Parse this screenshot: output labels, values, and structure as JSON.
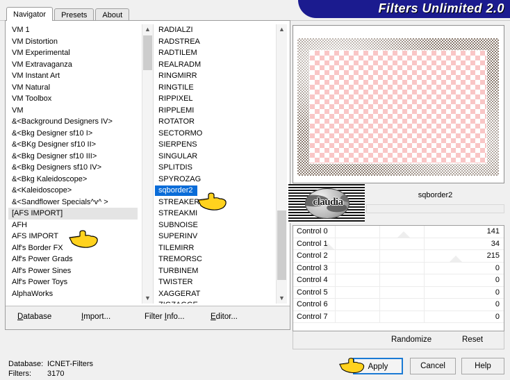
{
  "window": {
    "title": "Filters Unlimited 2.0",
    "title_color": "#1b1b8f"
  },
  "tabs": [
    {
      "label": "Navigator",
      "active": true
    },
    {
      "label": "Presets",
      "active": false
    },
    {
      "label": "About",
      "active": false
    }
  ],
  "category_list": {
    "name": "filter-category-list",
    "selected": "[AFS IMPORT]",
    "items": [
      "VM 1",
      "VM Distortion",
      "VM Experimental",
      "VM Extravaganza",
      "VM Instant Art",
      "VM Natural",
      "VM Toolbox",
      "VM",
      "&<Background Designers IV>",
      "&<Bkg Designer sf10 I>",
      "&<BKg Designer sf10 II>",
      "&<Bkg Designer sf10 III>",
      "&<Bkg Designers sf10 IV>",
      "&<Bkg Kaleidoscope>",
      "&<Kaleidoscope>",
      "&<Sandflower Specials^v^ >",
      "[AFS IMPORT]",
      "AFH",
      "AFS IMPORT",
      "Alf's Border FX",
      "Alf's Power Grads",
      "Alf's Power Sines",
      "Alf's Power Toys",
      "AlphaWorks"
    ]
  },
  "filter_list": {
    "name": "filter-name-list",
    "selected": "sqborder2",
    "items": [
      "RADIALZI",
      "RADSTREA",
      "RADTILEM",
      "REALRADM",
      "RINGMIRR",
      "RINGTILE",
      "RIPPIXEL",
      "RIPPLEMI",
      "ROTATOR",
      "SECTORMO",
      "SIERPENS",
      "SINGULAR",
      "SPLITDIS",
      "SPYROZAG",
      "sqborder2",
      "STREAKER",
      "STREAKMI",
      "SUBNOISE",
      "SUPERINV",
      "TILEMIRR",
      "TREMORSC",
      "TURBINEM",
      "TWISTER",
      "XAGGERAT",
      "ZIGZAGGE"
    ]
  },
  "frame_menu": [
    {
      "label": "Database",
      "accel": "D"
    },
    {
      "label": "Import...",
      "accel": "I"
    },
    {
      "label": "Filter Info...",
      "accel": "I"
    },
    {
      "label": "Editor...",
      "accel": "E"
    }
  ],
  "preview": {
    "name": "filter-preview"
  },
  "logo": {
    "word": "claudia"
  },
  "current_filter": {
    "name": "sqborder2"
  },
  "controls": {
    "rows": [
      {
        "label": "Control 0",
        "value": "141",
        "pos": 141
      },
      {
        "label": "Control 1",
        "value": "34",
        "pos": 34
      },
      {
        "label": "Control 2",
        "value": "215",
        "pos": 215
      },
      {
        "label": "Control 3",
        "value": "0",
        "pos": 0
      },
      {
        "label": "Control 4",
        "value": "0",
        "pos": 0
      },
      {
        "label": "Control 5",
        "value": "0",
        "pos": 0
      },
      {
        "label": "Control 6",
        "value": "0",
        "pos": 0
      },
      {
        "label": "Control 7",
        "value": "0",
        "pos": 0
      }
    ]
  },
  "control_actions": {
    "randomize": "Randomize",
    "reset": "Reset"
  },
  "status": {
    "database_key": "Database:",
    "database_value": "ICNET-Filters",
    "filters_key": "Filters:",
    "filters_value": "3170"
  },
  "buttons": {
    "apply": "Apply",
    "cancel": "Cancel",
    "help": "Help"
  }
}
